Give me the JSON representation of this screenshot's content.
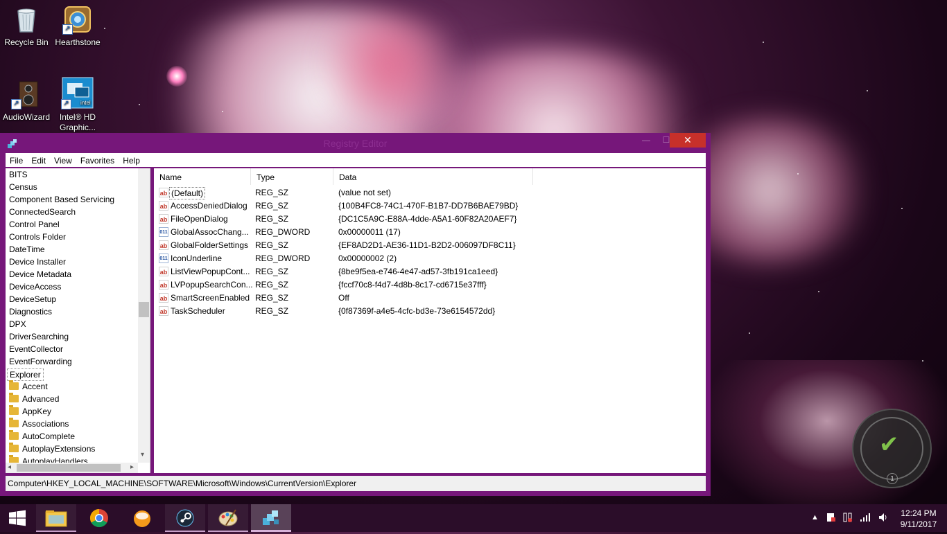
{
  "desktop": {
    "icons": [
      {
        "label": "Recycle Bin"
      },
      {
        "label": "Hearthstone"
      },
      {
        "label": "AudioWizard"
      },
      {
        "label": "Intel® HD Graphic..."
      }
    ]
  },
  "window": {
    "title": "Registry Editor",
    "minimize": "—",
    "maximize": "☐",
    "close": "✕",
    "menu": [
      "File",
      "Edit",
      "View",
      "Favorites",
      "Help"
    ],
    "tree": {
      "items": [
        "BITS",
        "Census",
        "Component Based Servicing",
        "ConnectedSearch",
        "Control Panel",
        "Controls Folder",
        "DateTime",
        "Device Installer",
        "Device Metadata",
        "DeviceAccess",
        "DeviceSetup",
        "Diagnostics",
        "DPX",
        "DriverSearching",
        "EventCollector",
        "EventForwarding"
      ],
      "selected": "Explorer",
      "children": [
        "Accent",
        "Advanced",
        "AppKey",
        "Associations",
        "AutoComplete",
        "AutoplayExtensions",
        "AutoplayHandlers"
      ]
    },
    "list": {
      "columns": [
        "Name",
        "Type",
        "Data"
      ],
      "rows": [
        {
          "icon": "string-value-icon",
          "name": "(Default)",
          "type": "REG_SZ",
          "data": "(value not set)"
        },
        {
          "icon": "string-value-icon",
          "name": "AccessDeniedDialog",
          "type": "REG_SZ",
          "data": "{100B4FC8-74C1-470F-B1B7-DD7B6BAE79BD}"
        },
        {
          "icon": "string-value-icon",
          "name": "FileOpenDialog",
          "type": "REG_SZ",
          "data": "{DC1C5A9C-E88A-4dde-A5A1-60F82A20AEF7}"
        },
        {
          "icon": "dword-value-icon",
          "name": "GlobalAssocChang...",
          "type": "REG_DWORD",
          "data": "0x00000011 (17)"
        },
        {
          "icon": "string-value-icon",
          "name": "GlobalFolderSettings",
          "type": "REG_SZ",
          "data": "{EF8AD2D1-AE36-11D1-B2D2-006097DF8C11}"
        },
        {
          "icon": "dword-value-icon",
          "name": "IconUnderline",
          "type": "REG_DWORD",
          "data": "0x00000002 (2)"
        },
        {
          "icon": "string-value-icon",
          "name": "ListViewPopupCont...",
          "type": "REG_SZ",
          "data": "{8be9f5ea-e746-4e47-ad57-3fb191ca1eed}"
        },
        {
          "icon": "string-value-icon",
          "name": "LVPopupSearchCon...",
          "type": "REG_SZ",
          "data": "{fccf70c8-f4d7-4d8b-8c17-cd6715e37fff}"
        },
        {
          "icon": "string-value-icon",
          "name": "SmartScreenEnabled",
          "type": "REG_SZ",
          "data": "Off"
        },
        {
          "icon": "string-value-icon",
          "name": "TaskScheduler",
          "type": "REG_SZ",
          "data": "{0f87369f-a4e5-4cfc-bd3e-73e6154572dd}"
        }
      ]
    },
    "status_path": "Computer\\HKEY_LOCAL_MACHINE\\SOFTWARE\\Microsoft\\Windows\\CurrentVersion\\Explorer"
  },
  "widget": {
    "badge": "1"
  },
  "taskbar": {
    "apps": [
      "start-icon",
      "file-explorer-icon",
      "chrome-icon",
      "app-orange-icon",
      "steam-icon",
      "paint-icon",
      "registry-editor-icon"
    ],
    "clock_time": "12:24 PM",
    "clock_date": "9/11/2017"
  }
}
